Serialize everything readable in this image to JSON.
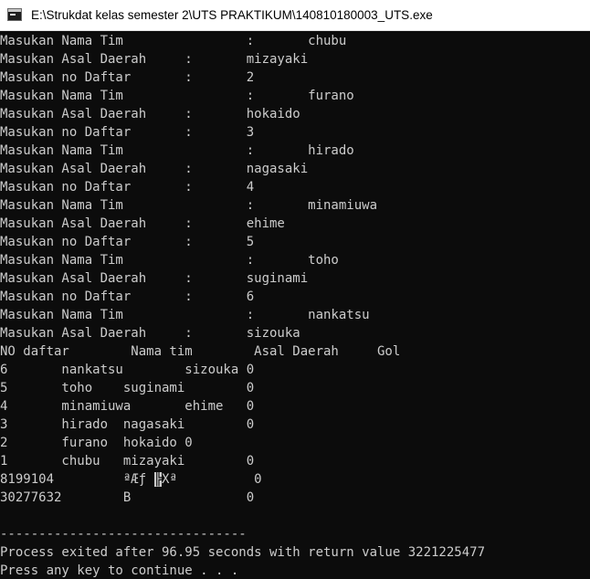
{
  "window": {
    "title": "E:\\Strukdat kelas semester 2\\UTS PRAKTIKUM\\140810180003_UTS.exe",
    "icon": "console-app-icon"
  },
  "console": {
    "text_color": "#cccccc",
    "background_color": "#0c0c0c",
    "lines": [
      "Masukan Nama Tim                :       chubu",
      "Masukan Asal Daerah     :       mizayaki",
      "Masukan no Daftar       :       2",
      "Masukan Nama Tim                :       furano",
      "Masukan Asal Daerah     :       hokaido",
      "Masukan no Daftar       :       3",
      "Masukan Nama Tim                :       hirado",
      "Masukan Asal Daerah     :       nagasaki",
      "Masukan no Daftar       :       4",
      "Masukan Nama Tim                :       minamiuwa",
      "Masukan Asal Daerah     :       ehime",
      "Masukan no Daftar       :       5",
      "Masukan Nama Tim                :       toho",
      "Masukan Asal Daerah     :       suginami",
      "Masukan no Daftar       :       6",
      "Masukan Nama Tim                :       nankatsu",
      "Masukan Asal Daerah     :       sizouka",
      "NO daftar        Nama tim        Asal Daerah     Gol",
      "6       nankatsu        sizouka 0",
      "5       toho    suginami        0",
      "4       minamiuwa       ehime   0",
      "3       hirado  nagasaki        0",
      "2       furano  hokaido 0",
      "1       chubu   mizayaki        0",
      "",
      "30277632        B               0",
      "",
      "--------------------------------",
      "Process exited after 96.95 seconds with return value 3221225477",
      "Press any key to continue . . ."
    ],
    "garbled_line": {
      "prefix": "8199104         ªÆƒ ",
      "block": "╠",
      "suffix": "Xª          0"
    }
  }
}
